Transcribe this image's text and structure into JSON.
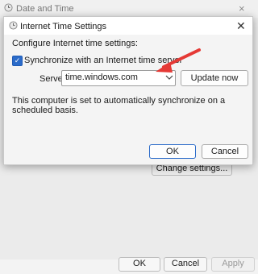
{
  "background_window": {
    "title": "Date and Time",
    "close_glyph": "×",
    "change_settings_label": "Change settings...",
    "ok_label": "OK",
    "cancel_label": "Cancel",
    "apply_label": "Apply"
  },
  "dialog": {
    "title": "Internet Time Settings",
    "close_glyph": "✕",
    "configure_label": "Configure Internet time settings:",
    "sync_checked": true,
    "sync_label": "Synchronize with an Internet time server",
    "server_label": "Server:",
    "server_value": "time.windows.com",
    "update_now_label": "Update now",
    "info_text": "This computer is set to automatically synchronize on a scheduled basis.",
    "ok_label": "OK",
    "cancel_label": "Cancel"
  },
  "icons": {
    "window_icon": "clock-icon",
    "dialog_icon": "clock-icon",
    "chevron": "chevron-down-icon",
    "checkmark": "check-icon",
    "annotation": "red-arrow-icon"
  },
  "colors": {
    "accent": "#2b6bc9",
    "annotation": "#e53935"
  }
}
